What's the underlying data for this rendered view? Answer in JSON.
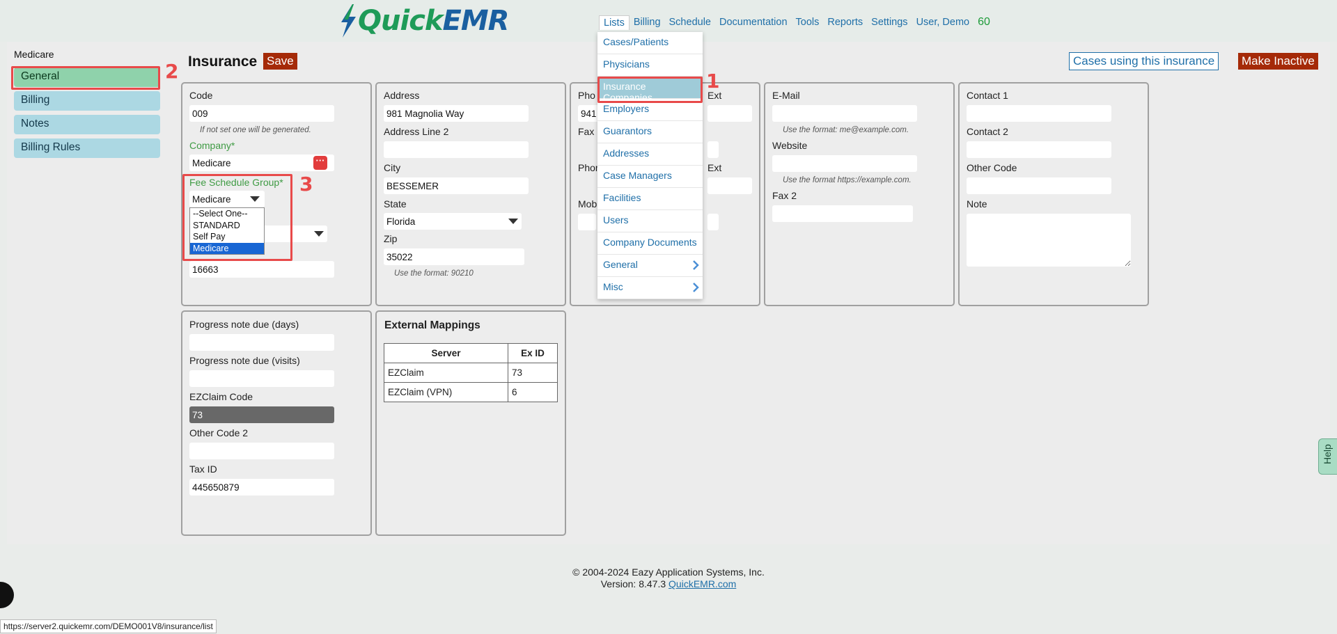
{
  "app": {
    "logo_quick": "Quick",
    "logo_emr": "EMR"
  },
  "nav": {
    "lists": "Lists",
    "billing": "Billing",
    "schedule": "Schedule",
    "documentation": "Documentation",
    "tools": "Tools",
    "reports": "Reports",
    "settings": "Settings",
    "user": "User, Demo",
    "count": "60"
  },
  "breadcrumb": "Medicare",
  "sidebar": {
    "items": [
      {
        "label": "General"
      },
      {
        "label": "Billing"
      },
      {
        "label": "Notes"
      },
      {
        "label": "Billing Rules"
      }
    ]
  },
  "annotations": {
    "one": "1",
    "two": "2",
    "three": "3"
  },
  "header": {
    "title": "Insurance",
    "save": "Save",
    "cases": "Cases using this insurance",
    "inactive": "Make Inactive"
  },
  "form": {
    "code_label": "Code",
    "code_value": "009",
    "code_hint": "If not set one will be generated.",
    "company_label": "Company*",
    "company_value": "Medicare",
    "fee_label": "Fee Schedule Group*",
    "fee_value": "Medicare",
    "fee_options": [
      "--Select One--",
      "STANDARD",
      "Self Pay",
      "Medicare"
    ],
    "hidden_value": "16663",
    "address_label": "Address",
    "address_value": "981 Magnolia Way",
    "address2_label": "Address Line 2",
    "address2_value": "",
    "city_label": "City",
    "city_value": "BESSEMER",
    "state_label": "State",
    "state_value": "Florida",
    "zip_label": "Zip",
    "zip_value": "35022",
    "zip_hint": "Use the format: 90210",
    "phone_label": "Pho",
    "phone_value": "941",
    "ext_label": "Ext",
    "fax_label": "Fax",
    "phone2_label": "Phor",
    "ext2_label": "Ext",
    "mobile_label": "Mob",
    "email_label": "E-Mail",
    "email_hint": "Use the format: me@example.com.",
    "website_label": "Website",
    "website_hint": "Use the format https://example.com.",
    "fax2_label": "Fax 2",
    "contact1_label": "Contact 1",
    "contact2_label": "Contact 2",
    "other_code_label": "Other Code",
    "note_label": "Note",
    "progress_days_label": "Progress note due (days)",
    "progress_visits_label": "Progress note due (visits)",
    "ezclaim_code_label": "EZClaim Code",
    "ezclaim_code_value": "73",
    "other_code2_label": "Other Code 2",
    "tax_id_label": "Tax ID",
    "tax_id_value": "445650879"
  },
  "external": {
    "title": "External Mappings",
    "headers": [
      "Server",
      "Ex ID"
    ],
    "rows": [
      {
        "server": "EZClaim",
        "id": "73"
      },
      {
        "server": "EZClaim (VPN)",
        "id": "6"
      }
    ]
  },
  "lists_menu": {
    "items": [
      "Cases/Patients",
      "Physicians",
      "Insurance Companies",
      "Employers",
      "Guarantors",
      "Addresses",
      "Case Managers",
      "Facilities",
      "Users",
      "Company Documents",
      "General",
      "Misc"
    ]
  },
  "footer": {
    "copyright": "© 2004-2024 Eazy Application Systems, Inc.",
    "version": "Version: 8.47.3",
    "link": "QuickEMR.com"
  },
  "status_url": "https://server2.quickemr.com/DEMO001V8/insurance/list",
  "help": "Help"
}
